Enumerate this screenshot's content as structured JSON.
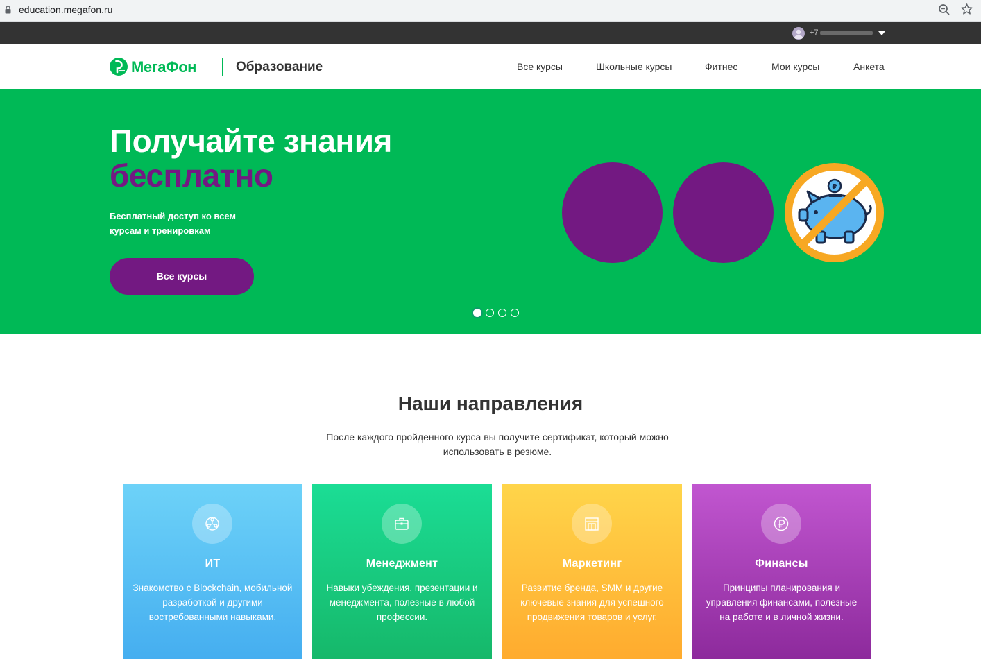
{
  "browser": {
    "url": "education.megafon.ru"
  },
  "topbar": {
    "phone_prefix": "+7"
  },
  "header": {
    "logo_text": "МегаФон",
    "logo_sub": "Образование",
    "nav": [
      "Все курсы",
      "Школьные курсы",
      "Фитнес",
      "Мои курсы",
      "Анкета"
    ]
  },
  "hero": {
    "title_line1": "Получайте знания",
    "title_line2": "бесплатно",
    "description": "Бесплатный доступ ко всем курсам и тренировкам",
    "button_label": "Все курсы",
    "slides_total": 4,
    "active_slide": 1,
    "colors": {
      "background": "#00b956",
      "accent": "#731982"
    }
  },
  "directions": {
    "title": "Наши направления",
    "subtitle": "После каждого пройденного курса вы получите сертификат, который можно использовать в резюме.",
    "cards": [
      {
        "title": "ИТ",
        "text": "Знакомство с Blockchain, мобильной разработкой и другими востребованными навыками.",
        "icon": "blockchain-icon",
        "color": "#45aef0"
      },
      {
        "title": "Менеджмент",
        "text": "Навыки убеждения, презентации и менеджмента, полезные в любой профессии.",
        "icon": "briefcase-icon",
        "color": "#16b86a"
      },
      {
        "title": "Маркетинг",
        "text": "Развитие бренда, SMM и другие ключевые знания для успешного продвижения товаров и услуг.",
        "icon": "storefront-icon",
        "color": "#ffab2e"
      },
      {
        "title": "Финансы",
        "text": "Принципы планирования и управления финансами, полезные на работе и в личной жизни.",
        "icon": "ruble-icon",
        "color": "#8d2a9c"
      }
    ]
  }
}
